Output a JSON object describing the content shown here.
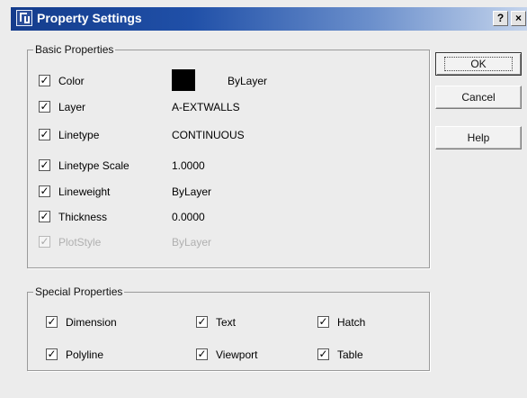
{
  "window": {
    "title": "Property Settings",
    "help_glyph": "?",
    "close_glyph": "×"
  },
  "check_glyph": "✓",
  "basic_properties": {
    "title": "Basic Properties",
    "rows": [
      {
        "label": "Color",
        "value": "ByLayer",
        "checked": true,
        "enabled": true,
        "swatch_color": "#000000"
      },
      {
        "label": "Layer",
        "value": "A-EXTWALLS",
        "checked": true,
        "enabled": true
      },
      {
        "label": "Linetype",
        "value": "CONTINUOUS",
        "checked": true,
        "enabled": true
      },
      {
        "label": "Linetype Scale",
        "value": "1.0000",
        "checked": true,
        "enabled": true
      },
      {
        "label": "Lineweight",
        "value": "ByLayer",
        "checked": true,
        "enabled": true
      },
      {
        "label": "Thickness",
        "value": "0.0000",
        "checked": true,
        "enabled": true
      },
      {
        "label": "PlotStyle",
        "value": "ByLayer",
        "checked": true,
        "enabled": false
      }
    ]
  },
  "special_properties": {
    "title": "Special Properties",
    "items": [
      {
        "label": "Dimension",
        "checked": true
      },
      {
        "label": "Text",
        "checked": true
      },
      {
        "label": "Hatch",
        "checked": true
      },
      {
        "label": "Polyline",
        "checked": true
      },
      {
        "label": "Viewport",
        "checked": true
      },
      {
        "label": "Table",
        "checked": true
      }
    ]
  },
  "buttons": {
    "ok": "OK",
    "cancel": "Cancel",
    "help": "Help"
  },
  "colors": {
    "title_bar_start": "#143c8c",
    "title_bar_end": "#c4d4ec",
    "dialog_background": "#ececec"
  }
}
